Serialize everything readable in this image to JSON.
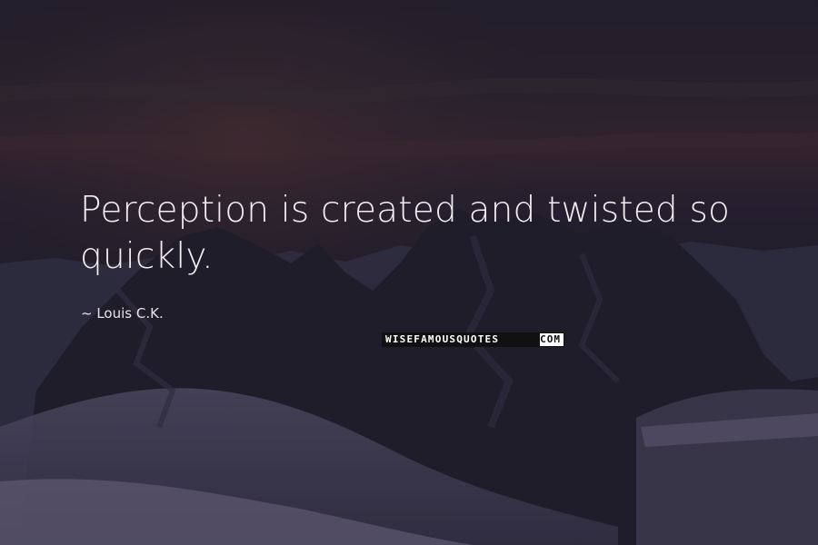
{
  "quote": {
    "line1": "Perception is created and twisted so",
    "line2": "quickly."
  },
  "author": {
    "text": "~ Louis C.K."
  },
  "watermark": {
    "main": "WISEFAMOUSQUOTES",
    "suffix": ".COM"
  },
  "colors": {
    "sky_top": "#2b2633",
    "sky_glow": "#4a2f3a",
    "mountain_dark": "#231f2d",
    "snow": "#6f6a85",
    "text": "#f2eef2"
  }
}
